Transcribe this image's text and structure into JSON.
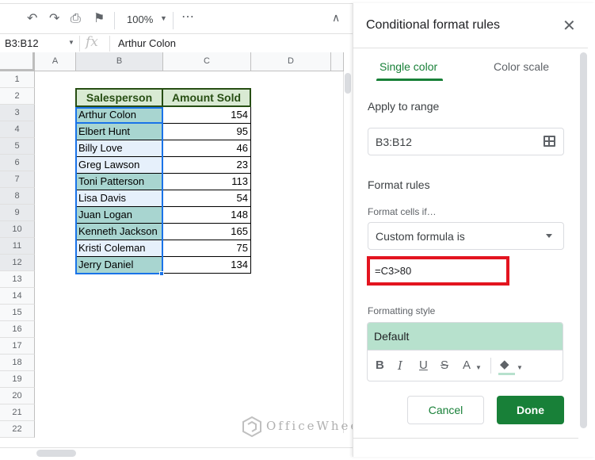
{
  "toolbar": {
    "icons": [
      "undo-icon",
      "redo-icon",
      "print-icon",
      "paint-format-icon",
      "more-icon",
      "collapse-icon"
    ],
    "zoom": "100%"
  },
  "formula_bar": {
    "name_box": "B3:B12",
    "fx": "fx",
    "value": "Arthur Colon"
  },
  "sheet": {
    "columns": [
      "A",
      "B",
      "C",
      "D"
    ],
    "rows": [
      "1",
      "2",
      "3",
      "4",
      "5",
      "6",
      "7",
      "8",
      "9",
      "10",
      "11",
      "12",
      "13",
      "14",
      "15",
      "16",
      "17",
      "18",
      "19",
      "20",
      "21",
      "22"
    ],
    "table": {
      "headers": [
        "Salesperson",
        "Amount Sold"
      ],
      "rows": [
        {
          "name": "Arthur Colon",
          "amount": "154",
          "highlight": true
        },
        {
          "name": "Elbert Hunt",
          "amount": "95",
          "highlight": true
        },
        {
          "name": "Billy Love",
          "amount": "46",
          "highlight": false
        },
        {
          "name": "Greg Lawson",
          "amount": "23",
          "highlight": false
        },
        {
          "name": "Toni Patterson",
          "amount": "113",
          "highlight": true
        },
        {
          "name": "Lisa Davis",
          "amount": "54",
          "highlight": false
        },
        {
          "name": "Juan Logan",
          "amount": "148",
          "highlight": true
        },
        {
          "name": "Kenneth Jackson",
          "amount": "165",
          "highlight": true
        },
        {
          "name": "Kristi Coleman",
          "amount": "75",
          "highlight": false
        },
        {
          "name": "Jerry Daniel",
          "amount": "134",
          "highlight": true
        }
      ]
    },
    "colors": {
      "highlight": "#a8d5d0",
      "selected": "#e6f0fb",
      "header_bg": "#d9ead3",
      "header_text": "#274e13"
    }
  },
  "panel": {
    "title": "Conditional format rules",
    "tabs": [
      "Single color",
      "Color scale"
    ],
    "apply_to_range_label": "Apply to range",
    "range": "B3:B12",
    "format_rules_label": "Format rules",
    "format_cells_if_label": "Format cells if…",
    "condition": "Custom formula is",
    "formula": "=C3>80",
    "formatting_style_label": "Formatting style",
    "style_preview": "Default",
    "style_buttons": {
      "bold": "B",
      "italic": "I",
      "underline": "U",
      "strike": "S",
      "text_color": "A"
    },
    "cancel": "Cancel",
    "done": "Done",
    "accent": "#188038"
  },
  "watermark": "OfficeWheel"
}
